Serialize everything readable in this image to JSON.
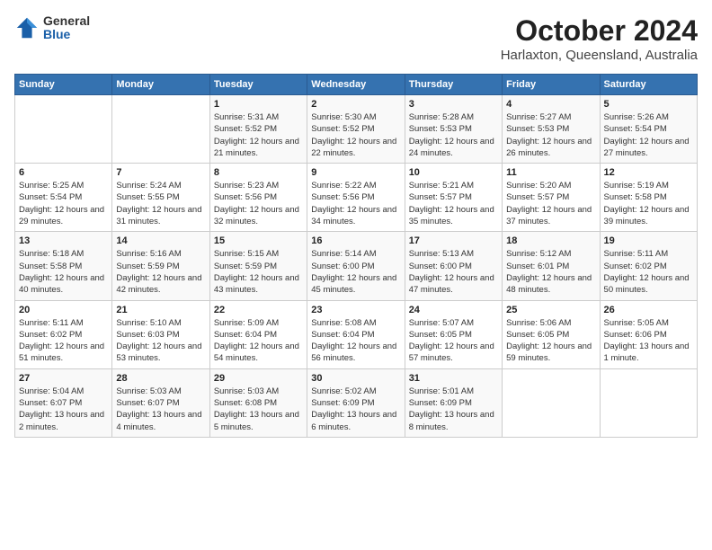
{
  "header": {
    "logo_general": "General",
    "logo_blue": "Blue",
    "month": "October 2024",
    "location": "Harlaxton, Queensland, Australia"
  },
  "weekdays": [
    "Sunday",
    "Monday",
    "Tuesday",
    "Wednesday",
    "Thursday",
    "Friday",
    "Saturday"
  ],
  "weeks": [
    [
      {
        "day": "",
        "detail": ""
      },
      {
        "day": "",
        "detail": ""
      },
      {
        "day": "1",
        "detail": "Sunrise: 5:31 AM\nSunset: 5:52 PM\nDaylight: 12 hours and 21 minutes."
      },
      {
        "day": "2",
        "detail": "Sunrise: 5:30 AM\nSunset: 5:52 PM\nDaylight: 12 hours and 22 minutes."
      },
      {
        "day": "3",
        "detail": "Sunrise: 5:28 AM\nSunset: 5:53 PM\nDaylight: 12 hours and 24 minutes."
      },
      {
        "day": "4",
        "detail": "Sunrise: 5:27 AM\nSunset: 5:53 PM\nDaylight: 12 hours and 26 minutes."
      },
      {
        "day": "5",
        "detail": "Sunrise: 5:26 AM\nSunset: 5:54 PM\nDaylight: 12 hours and 27 minutes."
      }
    ],
    [
      {
        "day": "6",
        "detail": "Sunrise: 5:25 AM\nSunset: 5:54 PM\nDaylight: 12 hours and 29 minutes."
      },
      {
        "day": "7",
        "detail": "Sunrise: 5:24 AM\nSunset: 5:55 PM\nDaylight: 12 hours and 31 minutes."
      },
      {
        "day": "8",
        "detail": "Sunrise: 5:23 AM\nSunset: 5:56 PM\nDaylight: 12 hours and 32 minutes."
      },
      {
        "day": "9",
        "detail": "Sunrise: 5:22 AM\nSunset: 5:56 PM\nDaylight: 12 hours and 34 minutes."
      },
      {
        "day": "10",
        "detail": "Sunrise: 5:21 AM\nSunset: 5:57 PM\nDaylight: 12 hours and 35 minutes."
      },
      {
        "day": "11",
        "detail": "Sunrise: 5:20 AM\nSunset: 5:57 PM\nDaylight: 12 hours and 37 minutes."
      },
      {
        "day": "12",
        "detail": "Sunrise: 5:19 AM\nSunset: 5:58 PM\nDaylight: 12 hours and 39 minutes."
      }
    ],
    [
      {
        "day": "13",
        "detail": "Sunrise: 5:18 AM\nSunset: 5:58 PM\nDaylight: 12 hours and 40 minutes."
      },
      {
        "day": "14",
        "detail": "Sunrise: 5:16 AM\nSunset: 5:59 PM\nDaylight: 12 hours and 42 minutes."
      },
      {
        "day": "15",
        "detail": "Sunrise: 5:15 AM\nSunset: 5:59 PM\nDaylight: 12 hours and 43 minutes."
      },
      {
        "day": "16",
        "detail": "Sunrise: 5:14 AM\nSunset: 6:00 PM\nDaylight: 12 hours and 45 minutes."
      },
      {
        "day": "17",
        "detail": "Sunrise: 5:13 AM\nSunset: 6:00 PM\nDaylight: 12 hours and 47 minutes."
      },
      {
        "day": "18",
        "detail": "Sunrise: 5:12 AM\nSunset: 6:01 PM\nDaylight: 12 hours and 48 minutes."
      },
      {
        "day": "19",
        "detail": "Sunrise: 5:11 AM\nSunset: 6:02 PM\nDaylight: 12 hours and 50 minutes."
      }
    ],
    [
      {
        "day": "20",
        "detail": "Sunrise: 5:11 AM\nSunset: 6:02 PM\nDaylight: 12 hours and 51 minutes."
      },
      {
        "day": "21",
        "detail": "Sunrise: 5:10 AM\nSunset: 6:03 PM\nDaylight: 12 hours and 53 minutes."
      },
      {
        "day": "22",
        "detail": "Sunrise: 5:09 AM\nSunset: 6:04 PM\nDaylight: 12 hours and 54 minutes."
      },
      {
        "day": "23",
        "detail": "Sunrise: 5:08 AM\nSunset: 6:04 PM\nDaylight: 12 hours and 56 minutes."
      },
      {
        "day": "24",
        "detail": "Sunrise: 5:07 AM\nSunset: 6:05 PM\nDaylight: 12 hours and 57 minutes."
      },
      {
        "day": "25",
        "detail": "Sunrise: 5:06 AM\nSunset: 6:05 PM\nDaylight: 12 hours and 59 minutes."
      },
      {
        "day": "26",
        "detail": "Sunrise: 5:05 AM\nSunset: 6:06 PM\nDaylight: 13 hours and 1 minute."
      }
    ],
    [
      {
        "day": "27",
        "detail": "Sunrise: 5:04 AM\nSunset: 6:07 PM\nDaylight: 13 hours and 2 minutes."
      },
      {
        "day": "28",
        "detail": "Sunrise: 5:03 AM\nSunset: 6:07 PM\nDaylight: 13 hours and 4 minutes."
      },
      {
        "day": "29",
        "detail": "Sunrise: 5:03 AM\nSunset: 6:08 PM\nDaylight: 13 hours and 5 minutes."
      },
      {
        "day": "30",
        "detail": "Sunrise: 5:02 AM\nSunset: 6:09 PM\nDaylight: 13 hours and 6 minutes."
      },
      {
        "day": "31",
        "detail": "Sunrise: 5:01 AM\nSunset: 6:09 PM\nDaylight: 13 hours and 8 minutes."
      },
      {
        "day": "",
        "detail": ""
      },
      {
        "day": "",
        "detail": ""
      }
    ]
  ]
}
